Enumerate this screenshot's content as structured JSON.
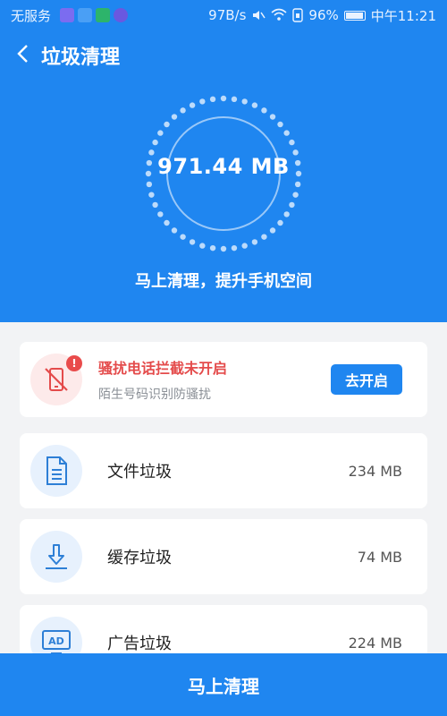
{
  "status_bar": {
    "carrier": "无服务",
    "speed": "97B/s",
    "battery": "96%",
    "time": "中午11:21"
  },
  "header": {
    "back_icon": "chevron-left-icon",
    "title": "垃圾清理"
  },
  "summary": {
    "total_size": "971.44 MB",
    "tip": "马上清理，提升手机空间"
  },
  "alert_card": {
    "icon": "call-block-icon",
    "badge": "!",
    "title": "骚扰电话拦截未开启",
    "subtitle": "陌生号码识别防骚扰",
    "button_label": "去开启"
  },
  "items": [
    {
      "icon": "document-icon",
      "label": "文件垃圾",
      "size": "234 MB"
    },
    {
      "icon": "download-icon",
      "label": "缓存垃圾",
      "size": "74 MB"
    },
    {
      "icon": "ad-icon",
      "label": "广告垃圾",
      "size": "224 MB"
    }
  ],
  "bottom_button": {
    "label": "马上清理"
  },
  "colors": {
    "primary": "#1f86f0",
    "alert": "#e44b4b",
    "background": "#f2f3f5"
  }
}
